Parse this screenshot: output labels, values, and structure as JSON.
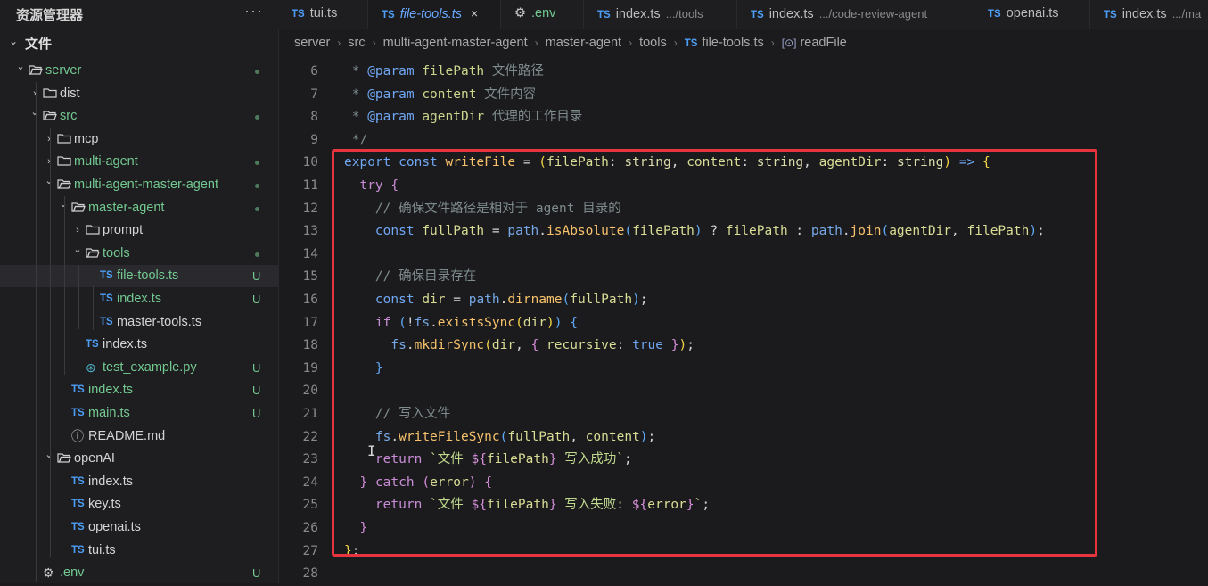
{
  "sidebar": {
    "title": "资源管理器",
    "more": "···",
    "section": "文件",
    "tree": [
      {
        "name": "server",
        "kind": "folder",
        "open": true,
        "color": "green",
        "status": "dot"
      },
      {
        "name": "dist",
        "kind": "folder",
        "open": false,
        "color": "plain",
        "status": ""
      },
      {
        "name": "src",
        "kind": "folder",
        "open": true,
        "color": "green",
        "status": "dot"
      },
      {
        "name": "mcp",
        "kind": "folder",
        "open": false,
        "color": "plain",
        "status": ""
      },
      {
        "name": "multi-agent",
        "kind": "folder",
        "open": false,
        "color": "green",
        "status": "dot"
      },
      {
        "name": "multi-agent-master-agent",
        "kind": "folder",
        "open": true,
        "color": "green",
        "status": "dot"
      },
      {
        "name": "master-agent",
        "kind": "folder",
        "open": true,
        "color": "green",
        "status": "dot"
      },
      {
        "name": "prompt",
        "kind": "folder",
        "open": false,
        "color": "plain",
        "status": ""
      },
      {
        "name": "tools",
        "kind": "folder",
        "open": true,
        "color": "green",
        "status": "dot"
      },
      {
        "name": "file-tools.ts",
        "kind": "ts",
        "color": "green",
        "status": "U",
        "active": true
      },
      {
        "name": "index.ts",
        "kind": "ts",
        "color": "green",
        "status": "U"
      },
      {
        "name": "master-tools.ts",
        "kind": "ts",
        "color": "plain",
        "status": ""
      },
      {
        "name": "index.ts",
        "kind": "ts",
        "color": "plain",
        "status": ""
      },
      {
        "name": "test_example.py",
        "kind": "py",
        "color": "green",
        "status": "U"
      },
      {
        "name": "index.ts",
        "kind": "ts",
        "color": "green",
        "status": "U"
      },
      {
        "name": "main.ts",
        "kind": "ts",
        "color": "green",
        "status": "U"
      },
      {
        "name": "README.md",
        "kind": "info",
        "color": "plain",
        "status": ""
      },
      {
        "name": "openAI",
        "kind": "folder",
        "open": true,
        "color": "plain",
        "status": ""
      },
      {
        "name": "index.ts",
        "kind": "ts",
        "color": "plain",
        "status": ""
      },
      {
        "name": "key.ts",
        "kind": "ts",
        "color": "plain",
        "status": ""
      },
      {
        "name": "openai.ts",
        "kind": "ts",
        "color": "plain",
        "status": ""
      },
      {
        "name": "tui.ts",
        "kind": "ts",
        "color": "plain",
        "status": ""
      },
      {
        "name": ".env",
        "kind": "gear",
        "color": "green",
        "status": "U"
      }
    ]
  },
  "tabs": [
    {
      "name": "tui.ts",
      "icon": "TS",
      "hint": ""
    },
    {
      "name": "file-tools.ts",
      "icon": "TS",
      "hint": "",
      "active": true,
      "close": "×"
    },
    {
      "name": ".env",
      "icon": "gear",
      "hint": ""
    },
    {
      "name": "index.ts",
      "icon": "TS",
      "hint": ".../tools"
    },
    {
      "name": "index.ts",
      "icon": "TS",
      "hint": ".../code-review-agent"
    },
    {
      "name": "openai.ts",
      "icon": "TS",
      "hint": ""
    },
    {
      "name": "index.ts",
      "icon": "TS",
      "hint": ".../ma"
    }
  ],
  "breadcrumb": [
    "server",
    "src",
    "multi-agent-master-agent",
    "master-agent",
    "tools",
    "file-tools.ts",
    "readFile"
  ],
  "editor": {
    "line_numbers": [
      "6",
      "7",
      "8",
      "9",
      "10",
      "11",
      "12",
      "13",
      "14",
      "15",
      "16",
      "17",
      "18",
      "19",
      "20",
      "21",
      "22",
      "23",
      "24",
      "25",
      "26",
      "27",
      "28"
    ]
  },
  "colors": {
    "accent": "#69a8ff",
    "highlight_border": "#e8343f",
    "git_untracked": "#73c991"
  },
  "icons": {
    "folder": "folder-icon",
    "ts": "typescript-file-icon",
    "py": "python-file-icon",
    "info": "info-icon",
    "gear": "gear-icon"
  }
}
